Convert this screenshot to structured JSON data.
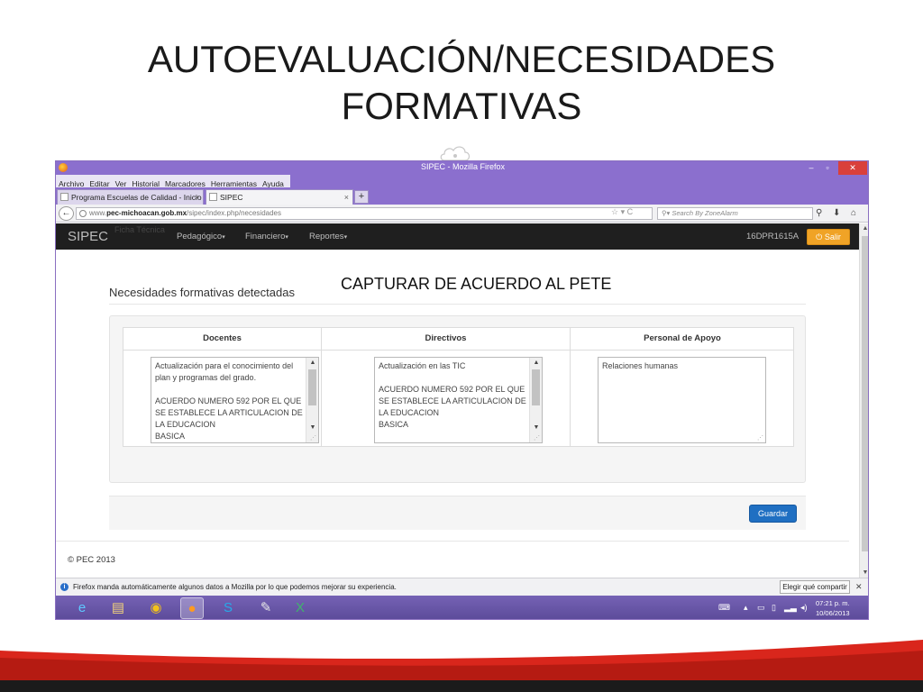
{
  "slide": {
    "title_line1": "AUTOEVALUACIÓN/NECESIDADES",
    "title_line2": "FORMATIVAS"
  },
  "browser": {
    "window_title": "SIPEC - Mozilla Firefox",
    "menu": [
      "Archivo",
      "Editar",
      "Ver",
      "Historial",
      "Marcadores",
      "Herramientas",
      "Ayuda"
    ],
    "tabs": [
      {
        "label": "Programa Escuelas de Calidad - Inicio",
        "active": false
      },
      {
        "label": "SIPEC",
        "active": true
      }
    ],
    "url_prefix": "www.",
    "url_host": "pec-michoacan.gob.mx",
    "url_path": "/sipec/index.php/necesidades",
    "search_placeholder": "Search By ZoneAlarm"
  },
  "app": {
    "brand": "SIPEC",
    "ghost_text": "Ficha Técnica",
    "nav": [
      "Pedagógico",
      "Financiero",
      "Reportes"
    ],
    "school_code": "16DPR1615A",
    "logout_label": "Salir",
    "page_heading": "Necesidades formativas detectadas",
    "annotation": "CAPTURAR DE ACUERDO AL PETE",
    "columns": [
      {
        "header": "Docentes",
        "text": "Actualización para el conocimiento del plan y programas del grado.\n\nACUERDO NUMERO 592 POR EL QUE SE ESTABLECE LA ARTICULACION DE LA EDUCACION\nBASICA"
      },
      {
        "header": "Directivos",
        "text": "Actualización en las TIC\n\nACUERDO NUMERO 592 POR EL QUE SE ESTABLECE LA ARTICULACION DE LA EDUCACION\nBASICA"
      },
      {
        "header": "Personal de Apoyo",
        "text": "Relaciones humanas"
      }
    ],
    "save_label": "Guardar",
    "footer": "© PEC 2013"
  },
  "notification": {
    "message": "Firefox manda automáticamente algunos datos a Mozilla por lo que podemos mejorar su experiencia.",
    "share_label": "Elegir qué compartir"
  },
  "taskbar": {
    "time": "07:21 p. m.",
    "date": "10/06/2013"
  },
  "colors": {
    "window_chrome": "#8b6fce",
    "app_navbar": "#1f1f1f",
    "logout_button": "#f0a326",
    "save_button": "#1f6fc2",
    "slide_accent": "#d9261c"
  }
}
